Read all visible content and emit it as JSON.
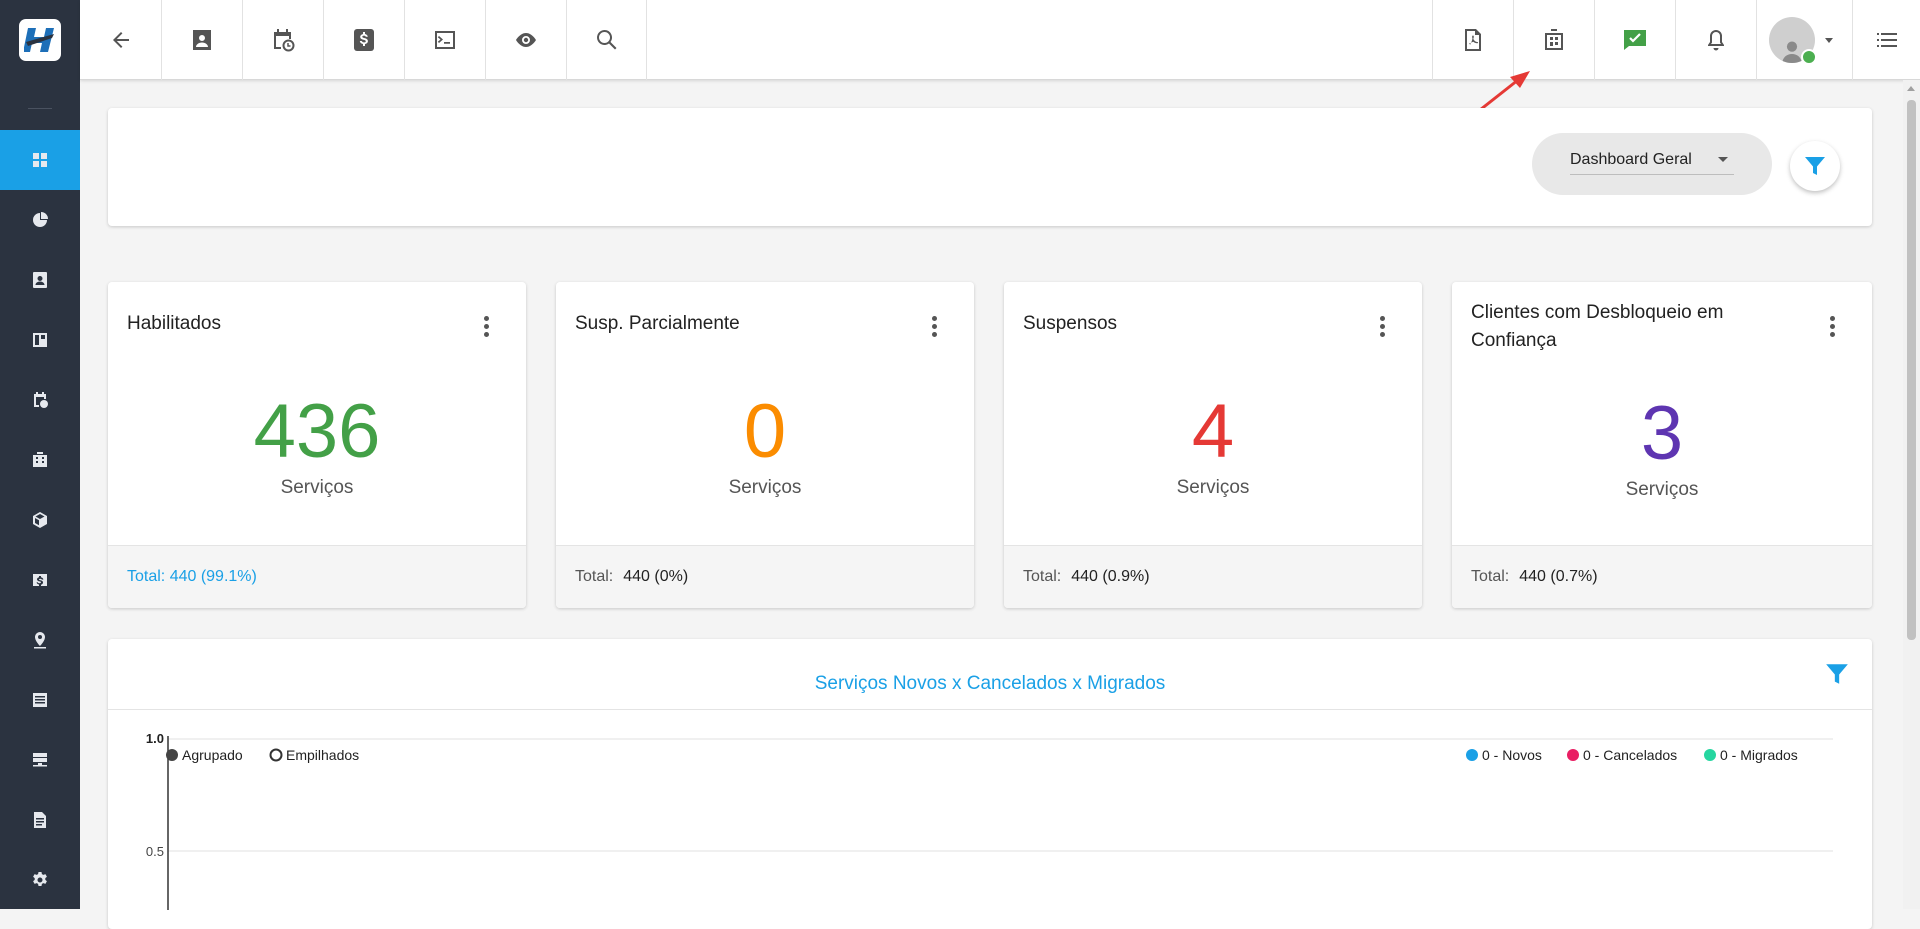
{
  "top_toolbar": {
    "icons": [
      "back-arrow-icon",
      "contact-card-icon",
      "calendar-clock-icon",
      "dollar-icon",
      "terminal-icon",
      "eye-icon",
      "search-icon",
      "pdf-icon",
      "building-icon",
      "chat-check-icon",
      "bell-icon",
      "user-avatar",
      "menu-list-icon"
    ]
  },
  "sidebar": {
    "items": [
      "dashboard",
      "pie-chart",
      "contact",
      "board",
      "calendar",
      "building",
      "package",
      "dollar",
      "map-pin",
      "list",
      "server",
      "document",
      "settings"
    ]
  },
  "header_card": {
    "dropdown_value": "Dashboard Geral"
  },
  "stats": [
    {
      "title": "Habilitados",
      "number": "436",
      "unit": "Serviços",
      "total_label": "Total: 440 (99.1%)",
      "total_value": "",
      "color": "#43a047"
    },
    {
      "title": "Susp. Parcialmente",
      "number": "0",
      "unit": "Serviços",
      "total_label": "Total:",
      "total_value": "440 (0%)",
      "color": "#fb8c00"
    },
    {
      "title": "Suspensos",
      "number": "4",
      "unit": "Serviços",
      "total_label": "Total:",
      "total_value": "440 (0.9%)",
      "color": "#e53935"
    },
    {
      "title": "Clientes com Desbloqueio em Confiança",
      "number": "3",
      "unit": "Serviços",
      "total_label": "Total:",
      "total_value": "440 (0.7%)",
      "color": "#5e35b1"
    }
  ],
  "chart": {
    "title": "Serviços Novos x Cancelados x Migrados",
    "modes": {
      "grouped": "Agrupado",
      "stacked": "Empilhados",
      "selected": "Agrupado"
    },
    "legend": [
      {
        "label": "0 - Novos",
        "color": "#1aa0e6"
      },
      {
        "label": "0 - Cancelados",
        "color": "#e91e63"
      },
      {
        "label": "0 - Migrados",
        "color": "#26d6a0"
      }
    ],
    "y_ticks": [
      "1.0",
      "0.5"
    ]
  },
  "chart_data": {
    "type": "bar",
    "title": "Serviços Novos x Cancelados x Migrados",
    "series": [
      {
        "name": "0 - Novos",
        "values": []
      },
      {
        "name": "0 - Cancelados",
        "values": []
      },
      {
        "name": "0 - Migrados",
        "values": []
      }
    ],
    "ylim": [
      0,
      1.0
    ],
    "y_ticks": [
      1.0,
      0.5
    ],
    "grid": true,
    "legend_position": "top-right"
  },
  "colors": {
    "accent": "#1aa0e6",
    "sidebar_bg": "#2b3340",
    "annotation_arrow": "#e53935"
  }
}
